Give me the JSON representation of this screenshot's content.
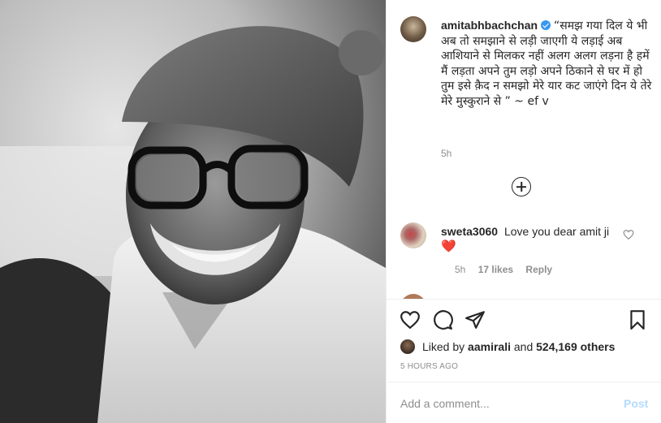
{
  "post": {
    "author": "amitabhbachchan",
    "caption": "“समझ गया दिल ये भी अब तो समझाने से लड़ी जाएगी ये लड़ाई अब आशियाने से मिलकर नहीं अलग अलग लड़ना है हमें मैं लड़ता अपने तुम लड़ो अपने ठिकाने से घर में हो तुम इसे क़ैद न समझो मेरे यार कट जाएंगे दिन ये तेरे मेरे मुस्कुराने से ” ~ ef v",
    "caption_time": "5h",
    "likes": {
      "liked_by_prefix": "Liked by",
      "liked_by_user": "aamirali",
      "and_word": "and",
      "others": "524,169 others"
    },
    "age": "5 HOURS AGO"
  },
  "comments": [
    {
      "username": "sweta3060",
      "text": "Love you dear amit ji",
      "emoji": "❤️",
      "time": "5h",
      "likes": "17 likes",
      "reply_label": "Reply"
    }
  ],
  "composer": {
    "placeholder": "Add a comment...",
    "post_label": "Post"
  },
  "icons": {
    "verified": "verified-badge-icon",
    "load_more": "plus-circle-icon",
    "like": "heart-outline-icon",
    "comment": "speech-bubble-icon",
    "share": "paper-plane-icon",
    "save": "bookmark-icon"
  },
  "colors": {
    "verified_blue": "#3897f0",
    "heart_red": "#ed4956",
    "post_disabled": "#b3dbff",
    "muted_text": "#8e8e8e"
  }
}
